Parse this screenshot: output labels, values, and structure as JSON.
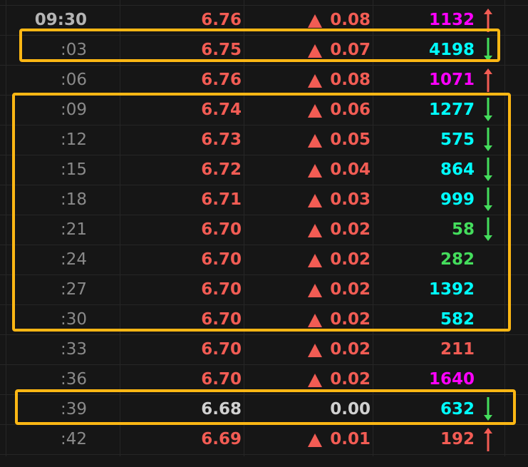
{
  "colors": {
    "up": "#f25c54",
    "flat": "#d0d0d0",
    "big_buy": "#ff00ff",
    "big_sell": "#00ffff",
    "small": "#44dd5c",
    "neutral": "#f25c54",
    "highlight": "#fdb714"
  },
  "rows": [
    {
      "time": "09:30",
      "price": "6.76",
      "dir": "up",
      "change": "0.08",
      "volume": "1132",
      "vol_color": "big_buy",
      "arrow": "up"
    },
    {
      "time": ":03",
      "price": "6.75",
      "dir": "up",
      "change": "0.07",
      "volume": "4198",
      "vol_color": "big_sell",
      "arrow": "down"
    },
    {
      "time": ":06",
      "price": "6.76",
      "dir": "up",
      "change": "0.08",
      "volume": "1071",
      "vol_color": "big_buy",
      "arrow": "up"
    },
    {
      "time": ":09",
      "price": "6.74",
      "dir": "up",
      "change": "0.06",
      "volume": "1277",
      "vol_color": "big_sell",
      "arrow": "down"
    },
    {
      "time": ":12",
      "price": "6.73",
      "dir": "up",
      "change": "0.05",
      "volume": "575",
      "vol_color": "big_sell",
      "arrow": "down"
    },
    {
      "time": ":15",
      "price": "6.72",
      "dir": "up",
      "change": "0.04",
      "volume": "864",
      "vol_color": "big_sell",
      "arrow": "down"
    },
    {
      "time": ":18",
      "price": "6.71",
      "dir": "up",
      "change": "0.03",
      "volume": "999",
      "vol_color": "big_sell",
      "arrow": "down"
    },
    {
      "time": ":21",
      "price": "6.70",
      "dir": "up",
      "change": "0.02",
      "volume": "58",
      "vol_color": "small",
      "arrow": "down"
    },
    {
      "time": ":24",
      "price": "6.70",
      "dir": "up",
      "change": "0.02",
      "volume": "282",
      "vol_color": "small",
      "arrow": ""
    },
    {
      "time": ":27",
      "price": "6.70",
      "dir": "up",
      "change": "0.02",
      "volume": "1392",
      "vol_color": "big_sell",
      "arrow": ""
    },
    {
      "time": ":30",
      "price": "6.70",
      "dir": "up",
      "change": "0.02",
      "volume": "582",
      "vol_color": "big_sell",
      "arrow": ""
    },
    {
      "time": ":33",
      "price": "6.70",
      "dir": "up",
      "change": "0.02",
      "volume": "211",
      "vol_color": "neutral",
      "arrow": ""
    },
    {
      "time": ":36",
      "price": "6.70",
      "dir": "up",
      "change": "0.02",
      "volume": "1640",
      "vol_color": "big_buy",
      "arrow": ""
    },
    {
      "time": ":39",
      "price": "6.68",
      "dir": "flat",
      "change": "0.00",
      "volume": "632",
      "vol_color": "big_sell",
      "arrow": "down"
    },
    {
      "time": ":42",
      "price": "6.69",
      "dir": "up",
      "change": "0.01",
      "volume": "192",
      "vol_color": "neutral",
      "arrow": "up"
    }
  ]
}
